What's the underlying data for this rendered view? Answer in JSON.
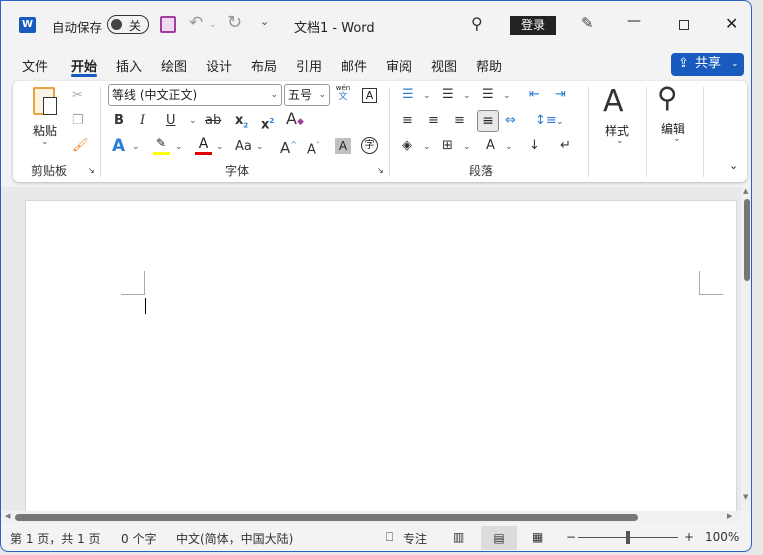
{
  "titlebar": {
    "autosave_label": "自动保存",
    "autosave_state": "关",
    "title": "文档1  -  Word",
    "signin": "登录"
  },
  "tabs": [
    "文件",
    "开始",
    "插入",
    "绘图",
    "设计",
    "布局",
    "引用",
    "邮件",
    "审阅",
    "视图",
    "帮助"
  ],
  "active_tab": "开始",
  "share_label": "共享",
  "ribbon": {
    "clipboard": {
      "paste": "粘贴",
      "label": "剪贴板"
    },
    "font": {
      "font_name": "等线 (中文正文)",
      "font_size": "五号",
      "label": "字体",
      "phonetic_top": "wén",
      "phonetic_bottom": "文"
    },
    "paragraph": {
      "label": "段落"
    },
    "styles": {
      "label": "样式"
    },
    "editing": {
      "label": "编辑"
    }
  },
  "status": {
    "page": "第 1 页，共 1 页",
    "words": "0 个字",
    "language": "中文(简体，中国大陆)",
    "focus": "专注",
    "zoom": "100%",
    "zoom_level": 100
  },
  "colors": {
    "accent": "#185abd",
    "highlight": "#ffff00",
    "font_color": "#e00000"
  }
}
